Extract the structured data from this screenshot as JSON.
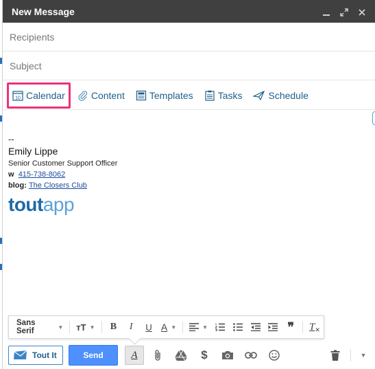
{
  "window": {
    "title": "New Message"
  },
  "fields": {
    "recipients_placeholder": "Recipients",
    "subject_placeholder": "Subject"
  },
  "toutbar": {
    "calendar_label": "Calendar",
    "calendar_icon_day": "10",
    "content_label": "Content",
    "templates_label": "Templates",
    "tasks_label": "Tasks",
    "schedule_label": "Schedule",
    "highlight_color": "#e8337a"
  },
  "signature": {
    "dashes": "--",
    "name": "Emily Lippe",
    "role": "Senior Customer Support Officer",
    "phone_label": "w",
    "phone": "415-738-8062",
    "blog_label": "blog:",
    "blog_link": "The Closers Club",
    "logo_bold": "tout",
    "logo_light": "app"
  },
  "format_toolbar": {
    "font_label": "Sans Serif",
    "size_label": "тT",
    "bold_label": "B",
    "italic_label": "I",
    "underline_label": "U",
    "textcolor_label": "A",
    "quote_label": "❞",
    "removeformat_label": "T"
  },
  "bottom": {
    "toutit_label": "Tout It",
    "send_label": "Send",
    "formatting_label": "A"
  },
  "colors": {
    "titlebar": "#404040",
    "accent_blue": "#4d90fe",
    "link_blue": "#1f5f8b"
  }
}
